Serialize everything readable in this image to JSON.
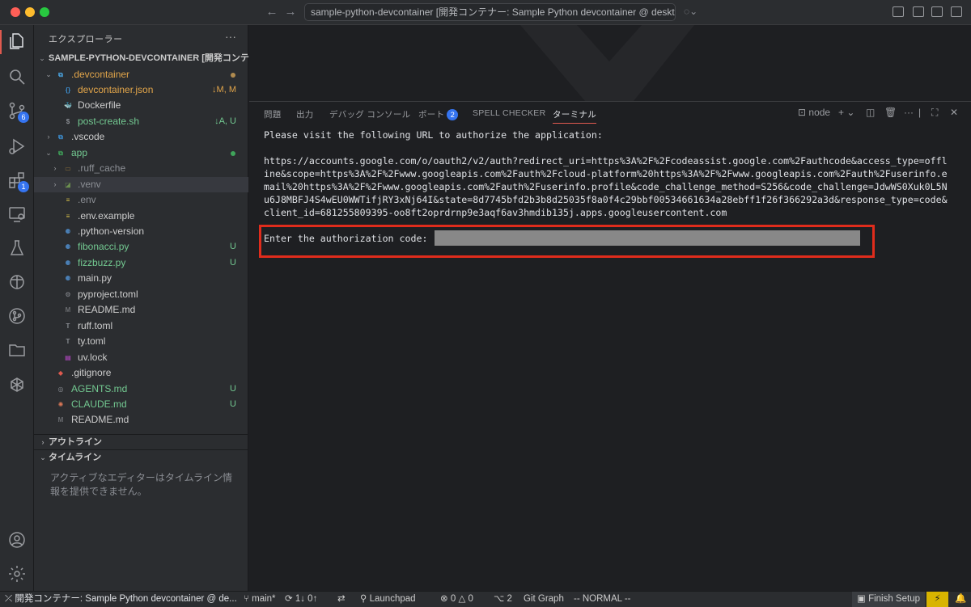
{
  "window": {
    "title": "sample-python-devcontainer [開発コンテナー: Sample Python devcontainer @ desktop-lin"
  },
  "sidebar": {
    "header": "エクスプローラー",
    "workspace": "SAMPLE-PYTHON-DEVCONTAINER [開発コンテ...",
    "items": [
      {
        "name": ".devcontainer",
        "color": "#e2a54a",
        "status": ""
      },
      {
        "name": "devcontainer.json",
        "color": "#e2a54a",
        "status": "↓M, M"
      },
      {
        "name": "Dockerfile",
        "color": "#cccccc",
        "status": ""
      },
      {
        "name": "post-create.sh",
        "color": "#73c991",
        "status": "↓A, U"
      },
      {
        "name": ".vscode",
        "color": "#cccccc",
        "status": ""
      },
      {
        "name": "app",
        "color": "#73c991",
        "status": ""
      },
      {
        "name": ".ruff_cache",
        "color": "#8b8e94",
        "status": ""
      },
      {
        "name": ".venv",
        "color": "#8b8e94",
        "status": ""
      },
      {
        "name": ".env",
        "color": "#8b8e94",
        "status": ""
      },
      {
        "name": ".env.example",
        "color": "#cccccc",
        "status": ""
      },
      {
        "name": ".python-version",
        "color": "#cccccc",
        "status": ""
      },
      {
        "name": "fibonacci.py",
        "color": "#73c991",
        "status": "U"
      },
      {
        "name": "fizzbuzz.py",
        "color": "#73c991",
        "status": "U"
      },
      {
        "name": "main.py",
        "color": "#cccccc",
        "status": ""
      },
      {
        "name": "pyproject.toml",
        "color": "#cccccc",
        "status": ""
      },
      {
        "name": "README.md",
        "color": "#cccccc",
        "status": ""
      },
      {
        "name": "ruff.toml",
        "color": "#cccccc",
        "status": ""
      },
      {
        "name": "ty.toml",
        "color": "#cccccc",
        "status": ""
      },
      {
        "name": "uv.lock",
        "color": "#cccccc",
        "status": ""
      },
      {
        "name": ".gitignore",
        "color": "#cccccc",
        "status": ""
      },
      {
        "name": "AGENTS.md",
        "color": "#73c991",
        "status": "U"
      },
      {
        "name": "CLAUDE.md",
        "color": "#73c991",
        "status": "U"
      },
      {
        "name": "README.md",
        "color": "#cccccc",
        "status": ""
      }
    ],
    "outline": "アウトライン",
    "timeline": "タイムライン",
    "timeline_msg": "アクティブなエディターはタイムライン情報を提供できません。"
  },
  "activity": {
    "scm_badge": "6",
    "ext_badge": "1"
  },
  "panel": {
    "tabs": {
      "problems": "問題",
      "output": "出力",
      "debug": "デバッグ コンソール",
      "ports": "ポート",
      "ports_badge": "2",
      "spell": "SPELL CHECKER",
      "terminal": "ターミナル"
    },
    "shell": "node",
    "terminal": {
      "line1": "Please visit the following URL to authorize the application:",
      "url1": "https://accounts.google.com/o/oauth2/v2/auth?redirect_uri=https%3A%2F%2Fcodeassist.google.com%2Fauthcode&access_type=offl",
      "url2": "ine&scope=https%3A%2F%2Fwww.googleapis.com%2Fauth%2Fcloud-platform%20https%3A%2F%2Fwww.googleapis.com%2Fauth%2Fuserinfo.e",
      "url3": "mail%20https%3A%2F%2Fwww.googleapis.com%2Fauth%2Fuserinfo.profile&code_challenge_method=S256&code_challenge=JdwWS0Xuk0L5N",
      "url4": "u6J8MBFJ4S4wEU0WWTifjRY3xNj64I&state=8d7745bfd2b3b8d25035f8a0f4c29bbf00534661634a28ebff1f26f366292a3d&response_type=code&",
      "url5": "client_id=681255809395-oo8ft2oprdrnp9e3aqf6av3hmdib135j.apps.googleusercontent.com",
      "prompt": "Enter the authorization code:"
    }
  },
  "statusbar": {
    "remote": "開発コンテナー: Sample Python devcontainer @ de...",
    "branch": "main*",
    "sync": "1↓ 0↑",
    "launchpad": "Launchpad",
    "errors": "0",
    "warnings": "0",
    "ports": "2",
    "gitgraph": "Git Graph",
    "mode": "-- NORMAL --",
    "finish": "Finish Setup"
  }
}
